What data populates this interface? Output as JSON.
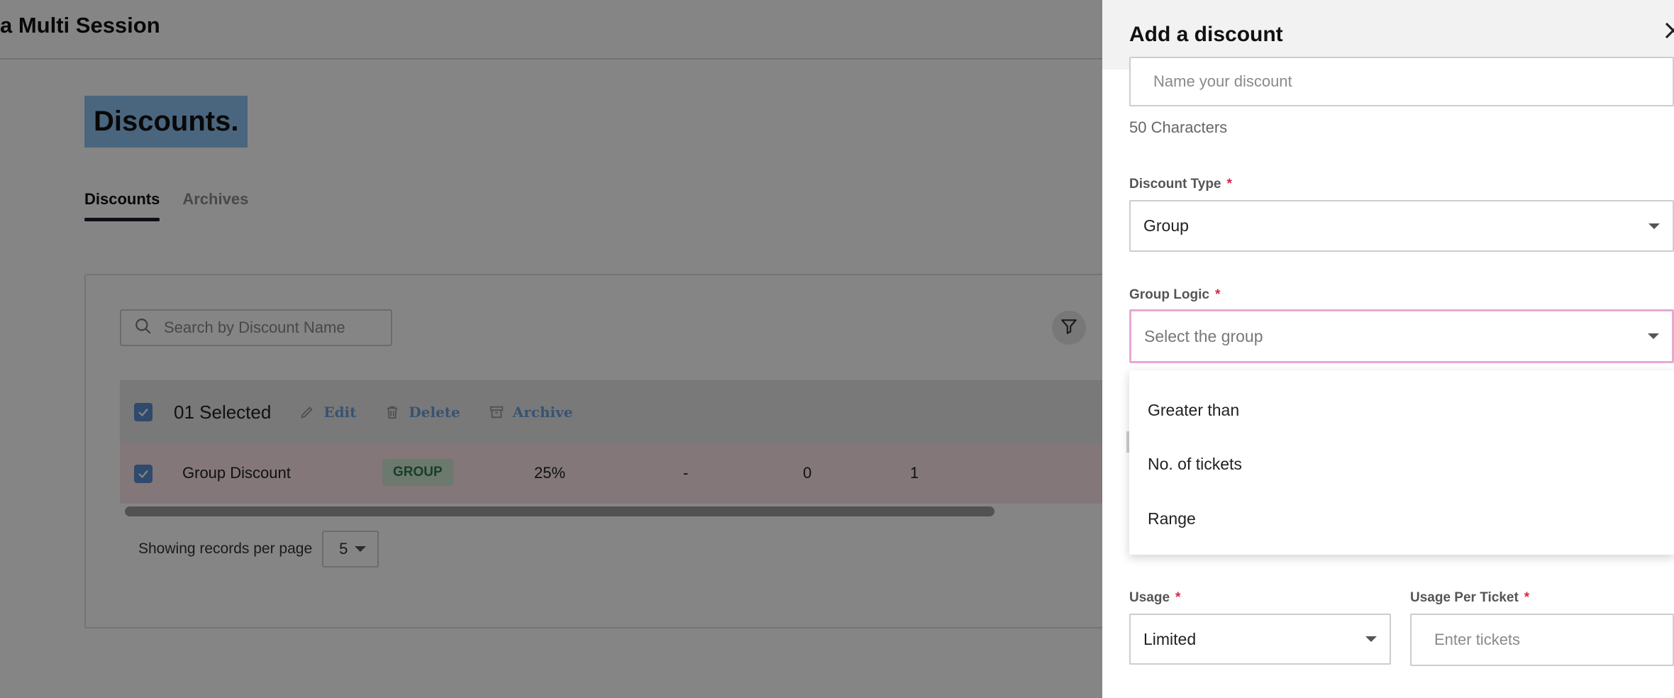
{
  "app": {
    "title": "a Multi Session"
  },
  "page": {
    "title": "Discounts."
  },
  "tabs": [
    {
      "label": "Discounts"
    },
    {
      "label": "Archives"
    }
  ],
  "search": {
    "placeholder": "Search by Discount Name"
  },
  "bulk": {
    "selected_text": "01 Selected",
    "edit": "Edit",
    "delete": "Delete",
    "archive": "Archive"
  },
  "table": {
    "rows": [
      {
        "name": "Group Discount",
        "type": "GROUP",
        "value": "25%",
        "col4": "-",
        "col5": "0",
        "col6": "1"
      }
    ]
  },
  "pagination": {
    "label": "Showing records per page",
    "per_page": "5"
  },
  "drawer": {
    "title": "Add a discount",
    "name_field": {
      "placeholder": "Name your discount",
      "helper": "50 Characters"
    },
    "discount_type": {
      "label": "Discount Type",
      "required": "*",
      "value": "Group"
    },
    "group_logic": {
      "label": "Group Logic",
      "required": "*",
      "placeholder": "Select the group",
      "options": [
        "Greater than",
        "No. of tickets",
        "Range"
      ]
    },
    "usage": {
      "label": "Usage",
      "required": "*",
      "value": "Limited"
    },
    "usage_per_ticket": {
      "label": "Usage Per Ticket",
      "required": "*",
      "placeholder": "Enter tickets"
    }
  },
  "colors": {
    "accent_blue": "#5b8fd0",
    "badge_bg": "#cfe8d4",
    "badge_text": "#2f7a4a",
    "required": "#d9264b",
    "focus_border": "#e7a8d4",
    "row_highlight": "#fbe4ea"
  },
  "icons": [
    "search-icon",
    "filter-icon",
    "check-icon",
    "pencil-icon",
    "trash-icon",
    "archive-icon",
    "close-icon",
    "caret-down-icon"
  ]
}
